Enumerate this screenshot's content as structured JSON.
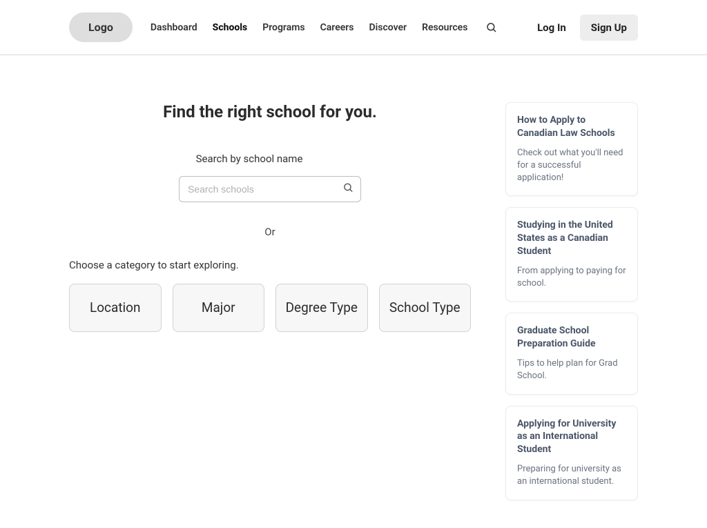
{
  "header": {
    "logo": "Logo",
    "nav": [
      {
        "label": "Dashboard",
        "active": false
      },
      {
        "label": "Schools",
        "active": true
      },
      {
        "label": "Programs",
        "active": false
      },
      {
        "label": "Careers",
        "active": false
      },
      {
        "label": "Discover",
        "active": false
      },
      {
        "label": "Resources",
        "active": false
      }
    ],
    "login": "Log In",
    "signup": "Sign Up"
  },
  "main": {
    "title": "Find the right school for you.",
    "search_label": "Search by school name",
    "search_placeholder": "Search schools",
    "or_label": "Or",
    "category_prompt": "Choose a category to start exploring.",
    "categories": [
      {
        "label": "Location"
      },
      {
        "label": "Major"
      },
      {
        "label": "Degree Type"
      },
      {
        "label": "School Type"
      }
    ]
  },
  "sidebar": [
    {
      "title": "How to Apply to Canadian Law Schools",
      "desc": "Check out what you'll need for a successful application!"
    },
    {
      "title": "Studying in the United States as a Canadian Student",
      "desc": "From applying to paying for school."
    },
    {
      "title": "Graduate School Preparation Guide",
      "desc": "Tips to help plan for Grad School."
    },
    {
      "title": "Applying for University as an International Student",
      "desc": "Preparing for university as an international student."
    }
  ]
}
